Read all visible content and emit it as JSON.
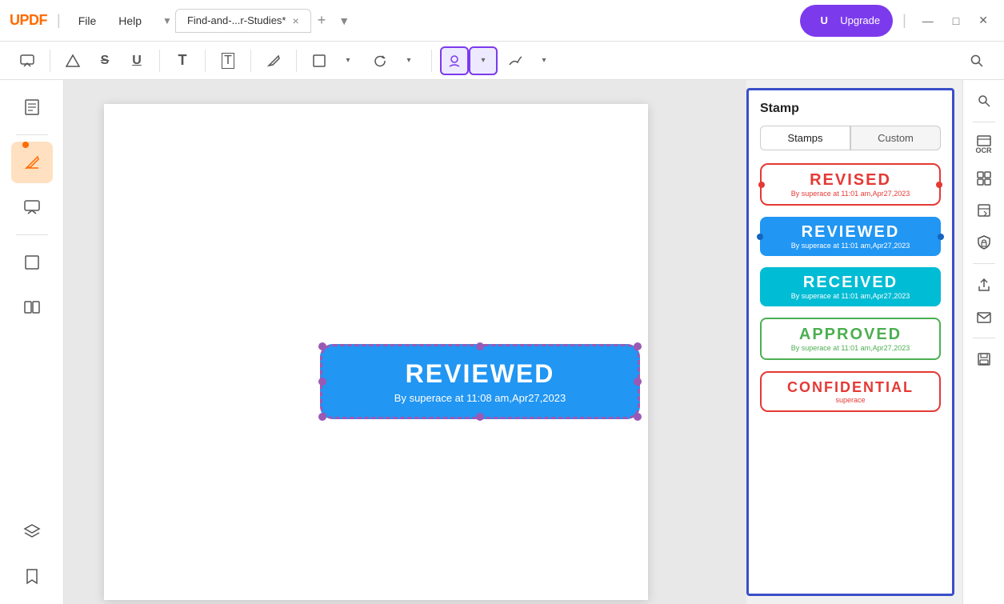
{
  "app": {
    "logo": "UPDF",
    "logo_color_u": "U"
  },
  "titlebar": {
    "file_menu": "File",
    "help_menu": "Help",
    "tab_name": "Find-and-...r-Studies*",
    "tab_close": "×",
    "tab_add": "+",
    "upgrade_label": "Upgrade",
    "upgrade_avatar": "U",
    "minimize": "—",
    "maximize": "□",
    "close": "✕"
  },
  "toolbar": {
    "comment_icon": "💬",
    "highlight_icon": "△",
    "strikethrough_icon": "S",
    "underline_icon": "U",
    "text_icon": "T",
    "text_box_icon": "T",
    "text_bg_icon": "T",
    "pen_icon": "✏",
    "shape_icon": "■",
    "stamp_icon": "👤",
    "sign_icon": "✒",
    "search_icon": "🔍"
  },
  "sidebar": {
    "items": [
      {
        "label": "Pages",
        "icon": "⊞"
      },
      {
        "label": "Edit",
        "icon": "✏"
      },
      {
        "label": "Comment",
        "icon": "📝"
      },
      {
        "label": "Crop",
        "icon": "⊡"
      },
      {
        "label": "Pages2",
        "icon": "📋"
      },
      {
        "label": "Layers",
        "icon": "⧉"
      },
      {
        "label": "Bookmark",
        "icon": "🔖"
      }
    ]
  },
  "page_stamp": {
    "title": "REVIEWED",
    "subtitle": "By superace at 11:08 am,Apr27,2023"
  },
  "stamp_panel": {
    "title": "Stamp",
    "tab_stamps": "Stamps",
    "tab_custom": "Custom",
    "stamps": [
      {
        "type": "revised",
        "title": "REVISED",
        "sub": "By superace at 11:01 am,Apr27,2023"
      },
      {
        "type": "reviewed",
        "title": "REVIEWED",
        "sub": "By superace at 11:01 am,Apr27,2023"
      },
      {
        "type": "received",
        "title": "RECEIVED",
        "sub": "By superace at 11:01 am,Apr27,2023"
      },
      {
        "type": "approved",
        "title": "APPROVED",
        "sub": "By superace at 11:01 am,Apr27,2023"
      },
      {
        "type": "confidential",
        "title": "CONFIDENTIAL",
        "sub": "superace"
      }
    ]
  },
  "right_sidebar": {
    "ocr": "OCR",
    "icons": [
      "🔍",
      "🗂",
      "📄",
      "🔒",
      "📤",
      "✉",
      "💾"
    ]
  }
}
